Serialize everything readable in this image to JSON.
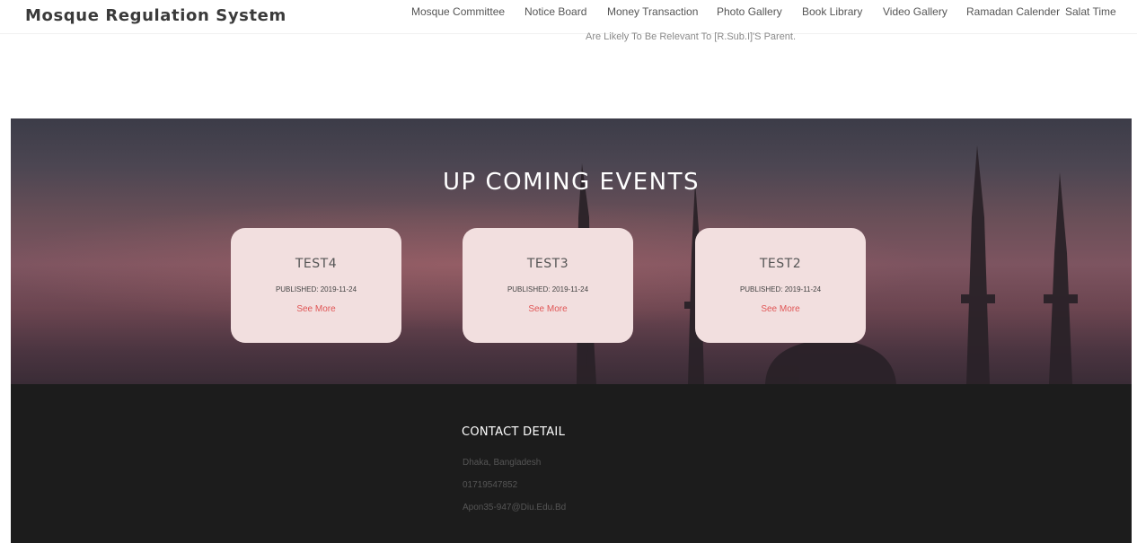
{
  "header": {
    "brand": "Mosque Regulation System",
    "nav": [
      "Mosque Committee",
      "Notice Board",
      "Money Transaction",
      "Photo Gallery",
      "Book Library",
      "Video Gallery",
      "Ramadan Calender",
      "Salat Time"
    ]
  },
  "intro": {
    "text": "Are Likely To Be Relevant To [R.Sub.I]'S Parent."
  },
  "events_section": {
    "title": "UP COMING EVENTS",
    "events": [
      {
        "title": "TEST4",
        "published": "PUBLISHED: 2019-11-24",
        "link": "See More"
      },
      {
        "title": "TEST3",
        "published": "PUBLISHED: 2019-11-24",
        "link": "See More"
      },
      {
        "title": "TEST2",
        "published": "PUBLISHED: 2019-11-24",
        "link": "See More"
      }
    ]
  },
  "footer": {
    "heading": "CONTACT DETAIL",
    "address": "Dhaka, Bangladesh",
    "phone": "01719547852",
    "email": "Apon35-947@Diu.Edu.Bd"
  },
  "colors": {
    "card_background": "#f2dfdf",
    "see_more_link": "#e05555",
    "footer_background": "#1c1c1c"
  }
}
